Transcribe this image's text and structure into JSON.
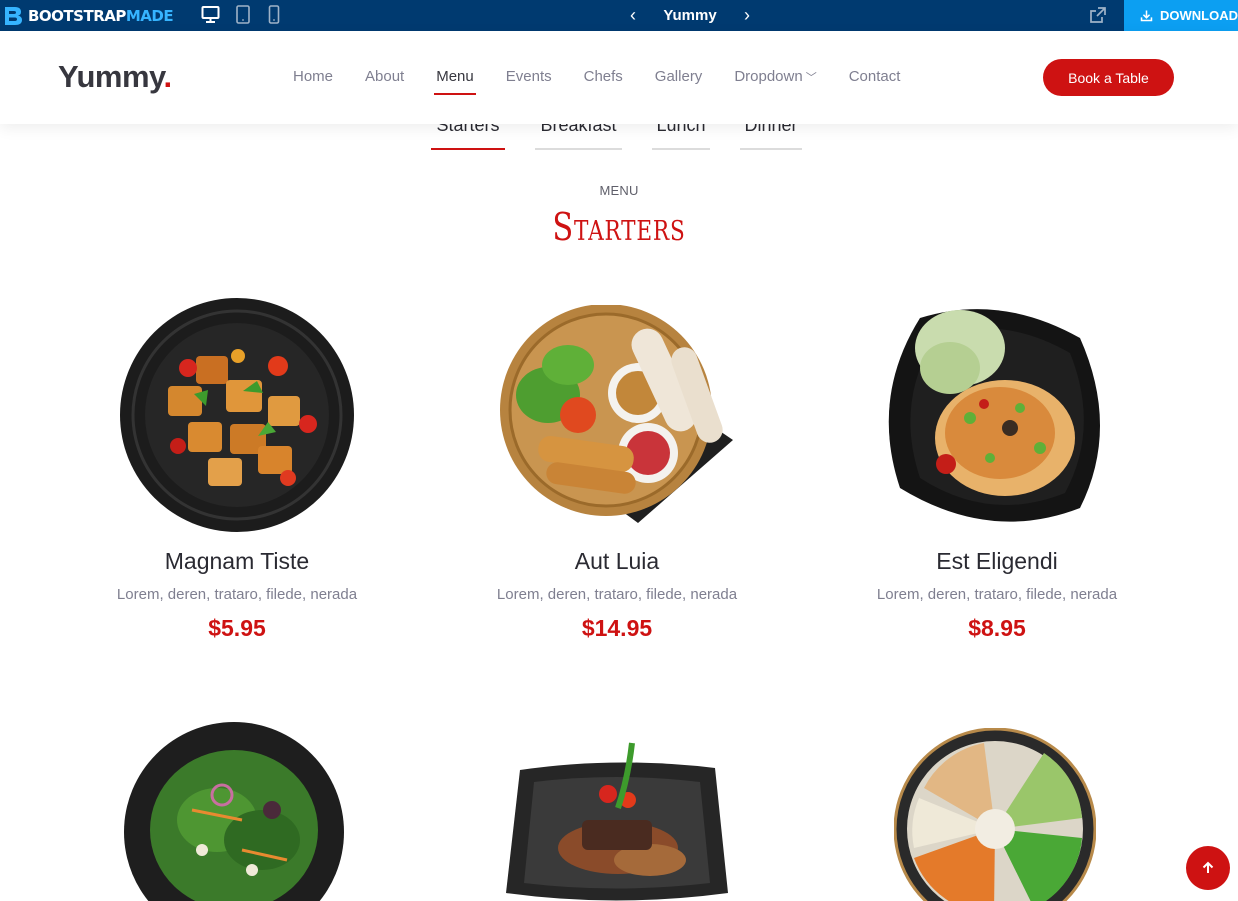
{
  "preview_bar": {
    "brand_main": "BOOTSTRAP",
    "brand_accent": "MADE",
    "template_name": "Yummy",
    "prev_icon": "chevron-left-icon",
    "next_icon": "chevron-right-icon",
    "download_label": "DOWNLOAD",
    "bar_color": "#003a70",
    "download_color": "#0c9ff2"
  },
  "header": {
    "brand": "Yummy",
    "brand_dot": ".",
    "nav": [
      {
        "label": "Home"
      },
      {
        "label": "About"
      },
      {
        "label": "Menu"
      },
      {
        "label": "Events"
      },
      {
        "label": "Chefs"
      },
      {
        "label": "Gallery"
      },
      {
        "label": "Dropdown"
      },
      {
        "label": "Contact"
      }
    ],
    "active_nav": "Menu",
    "cta": "Book a Table",
    "accent_color": "#ce1212"
  },
  "menu_tabs": [
    {
      "label": "Starters"
    },
    {
      "label": "Breakfast"
    },
    {
      "label": "Lunch"
    },
    {
      "label": "Dinner"
    }
  ],
  "section": {
    "subtitle": "MENU",
    "title": "Starters"
  },
  "items": [
    {
      "name": "Magnam Tiste",
      "ingredients": "Lorem, deren, trataro, filede, nerada",
      "price": "$5.95"
    },
    {
      "name": "Aut Luia",
      "ingredients": "Lorem, deren, trataro, filede, nerada",
      "price": "$14.95"
    },
    {
      "name": "Est Eligendi",
      "ingredients": "Lorem, deren, trataro, filede, nerada",
      "price": "$8.95"
    }
  ]
}
